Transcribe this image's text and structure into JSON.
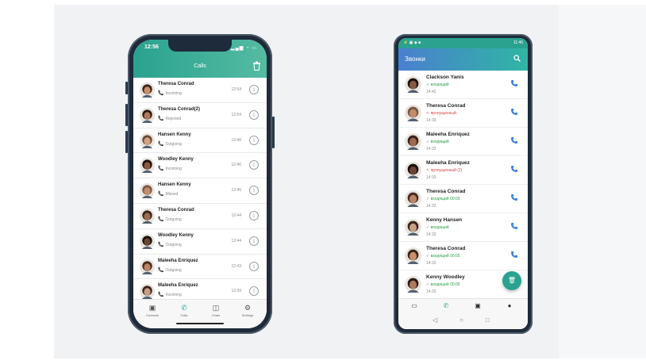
{
  "colors": {
    "accent": "#2aa28f",
    "android_header_start": "#4a7fd0",
    "green": "#2e9e4f",
    "red": "#d64545"
  },
  "iphone": {
    "status_time": "12:56",
    "title": "Calls",
    "calls": [
      {
        "name": "Theresa Conrad",
        "type": "Incoming",
        "time": "12:54",
        "dir": "in"
      },
      {
        "name": "Theresa Conrad(2)",
        "type": "Rejected",
        "time": "12:54",
        "dir": "rejected"
      },
      {
        "name": "Hansen Kenny",
        "type": "Outgoing",
        "time": "12:46",
        "dir": "out"
      },
      {
        "name": "Woodley Kenny",
        "type": "Incoming",
        "time": "12:46",
        "dir": "in"
      },
      {
        "name": "Hansen Kenny",
        "type": "Missed",
        "time": "12:45",
        "dir": "missed"
      },
      {
        "name": "Theresa Conrad",
        "type": "Outgoing",
        "time": "12:44",
        "dir": "out"
      },
      {
        "name": "Woodley Kenny",
        "type": "Outgoing",
        "time": "12:44",
        "dir": "out"
      },
      {
        "name": "Maleeha Enriquez",
        "type": "Outgoing",
        "time": "12:43",
        "dir": "out"
      },
      {
        "name": "Maleeha Enriquez",
        "type": "Incoming",
        "time": "12:39",
        "dir": "in"
      }
    ],
    "tabs": [
      {
        "label": "Contacts",
        "icon": "contacts-icon"
      },
      {
        "label": "Calls",
        "icon": "phone-icon"
      },
      {
        "label": "Chats",
        "icon": "chat-icon"
      },
      {
        "label": "Settings",
        "icon": "gear-icon"
      }
    ]
  },
  "android": {
    "status_time": "11:46",
    "title": "Звонки",
    "calls": [
      {
        "name": "Clackson Yanis",
        "sub": "✓ входящий",
        "time": "14:42",
        "status": "in"
      },
      {
        "name": "Theresa Conrad",
        "sub": "↖ пропущенный",
        "time": "14:33",
        "status": "missed"
      },
      {
        "name": "Maleeha Enriquez",
        "sub": "✓ входящий",
        "time": "14:33",
        "status": "in"
      },
      {
        "name": "Maleeha Enriquez",
        "sub": "↖ пропущенный (2)",
        "time": "14:33",
        "status": "missed"
      },
      {
        "name": "Theresa Conrad",
        "sub": "✓ входящий 00:03",
        "time": "14:32",
        "status": "in"
      },
      {
        "name": "Kenny Hansen",
        "sub": "✓ входящий",
        "time": "14:32",
        "status": "in"
      },
      {
        "name": "Theresa Conrad",
        "sub": "✓ входящий 00:05",
        "time": "14:32",
        "status": "in"
      },
      {
        "name": "Kenny Woodley",
        "sub": "✓ входящий 00:05",
        "time": "14:32",
        "status": "in"
      }
    ],
    "tabs": [
      "chat-icon",
      "phone-icon",
      "contacts-icon",
      "person-icon"
    ],
    "nav": [
      "back-icon",
      "home-icon",
      "recents-icon"
    ]
  }
}
